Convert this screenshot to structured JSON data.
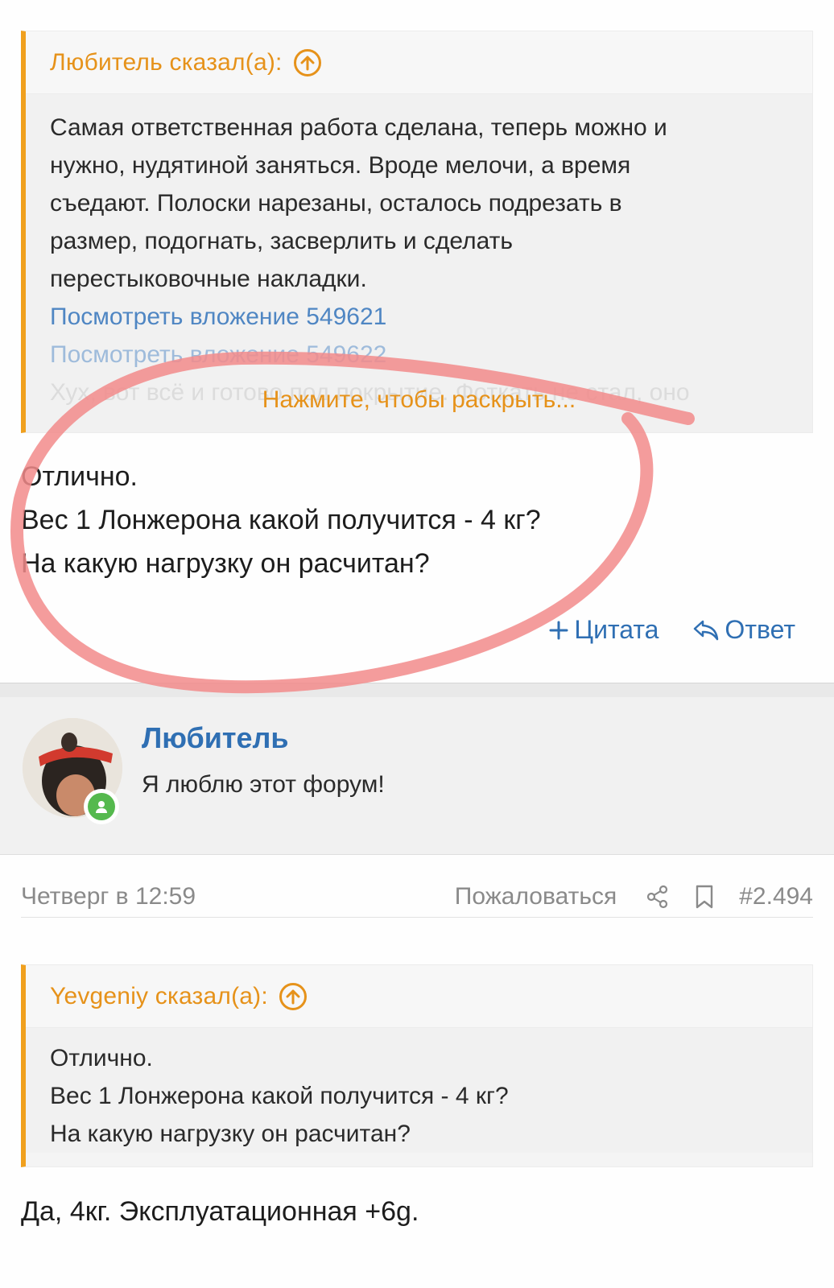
{
  "quote1": {
    "author_header": "Любитель сказал(а):",
    "lines": [
      "Самая ответственная работа сделана, теперь можно и",
      "нужно, нудятиной заняться. Вроде мелочи, а время",
      "съедают. Полоски нарезаны, осталось подрезать в",
      "размер, подогнать, засверлить и сделать",
      "перестыковочные накладки."
    ],
    "attachment1": "Посмотреть вложение 549621",
    "attachment2": "Посмотреть вложение 549622",
    "faded_line": "Хух, вот всё и готово под покрытие. Фоткать не стал, оно",
    "expand_label": "Нажмите, чтобы раскрыть..."
  },
  "post1": {
    "lines": [
      "Отлично.",
      "Вес 1 Лонжерона какой получится - 4 кг?",
      "На какую нагрузку он расчитан?"
    ]
  },
  "actions": {
    "quote_label": "Цитата",
    "reply_label": "Ответ"
  },
  "user": {
    "name": "Любитель",
    "title": "Я люблю этот форум!"
  },
  "meta": {
    "date": "Четверг в 12:59",
    "report": "Пожаловаться",
    "post_number": "#2.494"
  },
  "quote2": {
    "author_header": "Yevgeniy сказал(а):",
    "lines": [
      "Отлично.",
      "Вес 1 Лонжерона какой получится - 4 кг?",
      "На какую нагрузку он расчитан?"
    ]
  },
  "post2": {
    "text": "Да, 4кг. Эксплуатационная +6g."
  },
  "colors": {
    "accent_orange": "#e6921a",
    "link_blue": "#2f6fb3",
    "online_green": "#55b94e",
    "annotation_red": "#f28b8b"
  }
}
